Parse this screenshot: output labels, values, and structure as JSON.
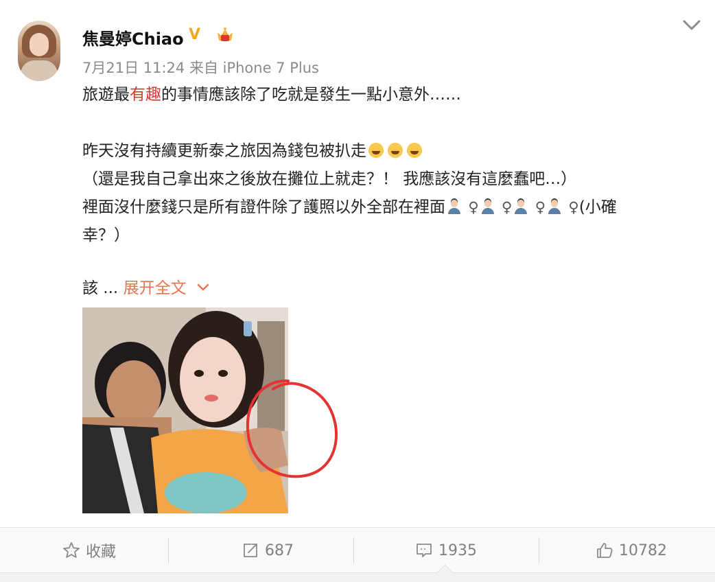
{
  "post": {
    "username": "焦曼婷Chiao",
    "verified_badge": "V",
    "meta": "7月21日 11:24 来自 iPhone 7 Plus",
    "line1_pre": "旅遊最",
    "line1_hl": "有趣",
    "line1_post": "的事情應該除了吃就是發生一點小意外……",
    "line2": "昨天沒有持續更新泰之旅因為錢包被扒走",
    "line3": "（還是我自己拿出來之後放在攤位上就走？！ 我應該沒有這麼蠢吧…）",
    "line4": "裡面沒什麼錢只是所有證件除了護照以外全部在裡面",
    "female_sign": "♀",
    "line4_tail": "(小確",
    "line5": "幸？）",
    "truncated_prefix": "該 ...",
    "expand_label": "展开全文",
    "accent_color": "#eb7350",
    "highlight_color": "#e0352b"
  },
  "actions": {
    "favorite_label": "收藏",
    "repost_count": "687",
    "comment_count": "1935",
    "like_count": "10782"
  },
  "icons": {
    "chevron": "chevron-down-icon",
    "favorite": "star-outline-icon",
    "repost": "repost-icon",
    "comment": "comment-icon",
    "like": "thumbs-up-icon"
  }
}
